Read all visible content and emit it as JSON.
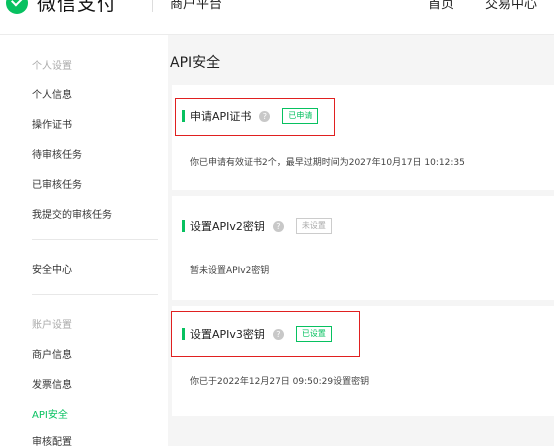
{
  "header": {
    "logo_text": "微信支付",
    "title": "商户平台",
    "nav": [
      {
        "label": "首页"
      },
      {
        "label": "交易中心"
      }
    ]
  },
  "sidebar": {
    "groups": [
      {
        "label": "个人设置"
      },
      {
        "label": "账户设置"
      }
    ],
    "personal_items": [
      {
        "label": "个人信息"
      },
      {
        "label": "操作证书"
      },
      {
        "label": "待审核任务"
      },
      {
        "label": "已审核任务"
      },
      {
        "label": "我提交的审核任务"
      }
    ],
    "security_center": {
      "label": "安全中心"
    },
    "account_items": [
      {
        "label": "商户信息"
      },
      {
        "label": "发票信息"
      },
      {
        "label": "API安全"
      },
      {
        "label": "审核配置"
      }
    ]
  },
  "main": {
    "title": "API安全",
    "sections": [
      {
        "title": "申请API证书",
        "help_icon": "?",
        "badge": "已申请",
        "badge_color": "#07c160",
        "body": "你已申请有效证书2个，最早过期时间为2027年10月17日 10:12:35"
      },
      {
        "title": "设置APIv2密钥",
        "help_icon": "?",
        "badge": "未设置",
        "badge_color": "#aaaaaa",
        "body": "暂未设置APIv2密钥"
      },
      {
        "title": "设置APIv3密钥",
        "help_icon": "?",
        "badge": "已设置",
        "badge_color": "#07c160",
        "body": "你已于2022年12月27日 09:50:29设置密钥"
      }
    ]
  },
  "colors": {
    "accent": "#07c160",
    "highlight": "#e02020"
  }
}
